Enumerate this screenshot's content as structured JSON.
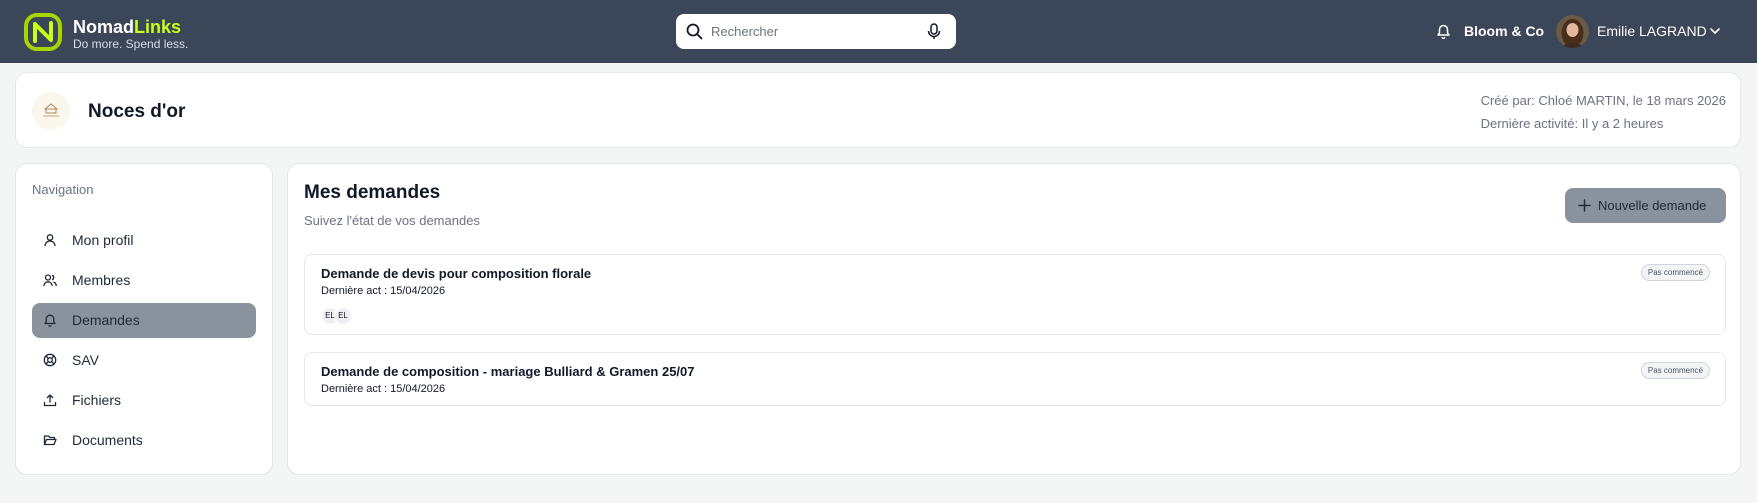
{
  "brand": {
    "name_part1": "Nomad",
    "name_part2": "Links",
    "tagline": "Do more. Spend less."
  },
  "search": {
    "placeholder": "Rechercher"
  },
  "header": {
    "org_name": "Bloom & Co",
    "user_name": "Emilie LAGRAND"
  },
  "project": {
    "title": "Noces d'or",
    "created_by": "Créé par: Chloé MARTIN, le 18 mars 2026",
    "last_activity": "Dernière activité: Il y a 2 heures"
  },
  "nav": {
    "title": "Navigation",
    "items": [
      {
        "label": "Mon profil",
        "icon": "user-icon"
      },
      {
        "label": "Membres",
        "icon": "users-icon"
      },
      {
        "label": "Demandes",
        "icon": "bell-icon",
        "active": true
      },
      {
        "label": "SAV",
        "icon": "lifebuoy-icon"
      },
      {
        "label": "Fichiers",
        "icon": "upload-icon"
      },
      {
        "label": "Documents",
        "icon": "folder-open-icon"
      }
    ]
  },
  "main": {
    "title": "Mes demandes",
    "subtitle": "Suivez l'état de vos demandes",
    "new_button": "Nouvelle demande",
    "requests": [
      {
        "title": "Demande de devis pour composition florale",
        "last_activity": "Dernière act : 15/04/2026",
        "status": "Pas commencé",
        "members": [
          "EL",
          "EL"
        ]
      },
      {
        "title": "Demande de composition - mariage Bulliard & Gramen 25/07",
        "last_activity": "Dernière act : 15/04/2026",
        "status": "Pas commencé",
        "members": []
      }
    ]
  },
  "colors": {
    "topbar": "#3b4658",
    "brand_accent": "#c6ff1a",
    "active_nav": "#8a939d",
    "button": "#8a939d"
  }
}
